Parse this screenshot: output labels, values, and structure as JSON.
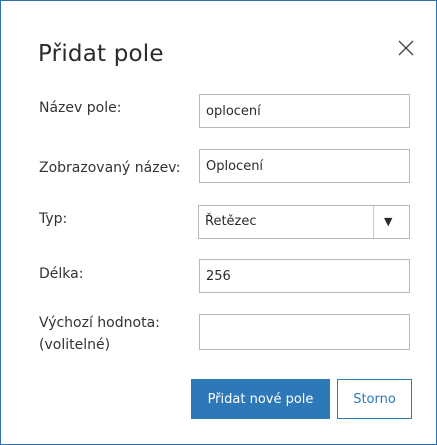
{
  "dialog": {
    "title": "Přidat pole",
    "close_icon": "close-icon"
  },
  "form": {
    "field_name": {
      "label": "Název pole:",
      "value": "oplocení"
    },
    "display_name": {
      "label": "Zobrazovaný název:",
      "value": "Oplocení"
    },
    "type": {
      "label": "Typ:",
      "selected": "Řetězec",
      "arrow_icon": "chevron-down-icon"
    },
    "length": {
      "label": "Délka:",
      "value": "256"
    },
    "default_value": {
      "label_line1": "Výchozí hodnota:",
      "label_line2": "(volitelné)",
      "value": ""
    }
  },
  "buttons": {
    "add_label": "Přidat nové pole",
    "cancel_label": "Storno"
  },
  "colors": {
    "accent": "#2d78b9",
    "border": "#2f6fb3",
    "input_border": "#b9b9b9"
  }
}
